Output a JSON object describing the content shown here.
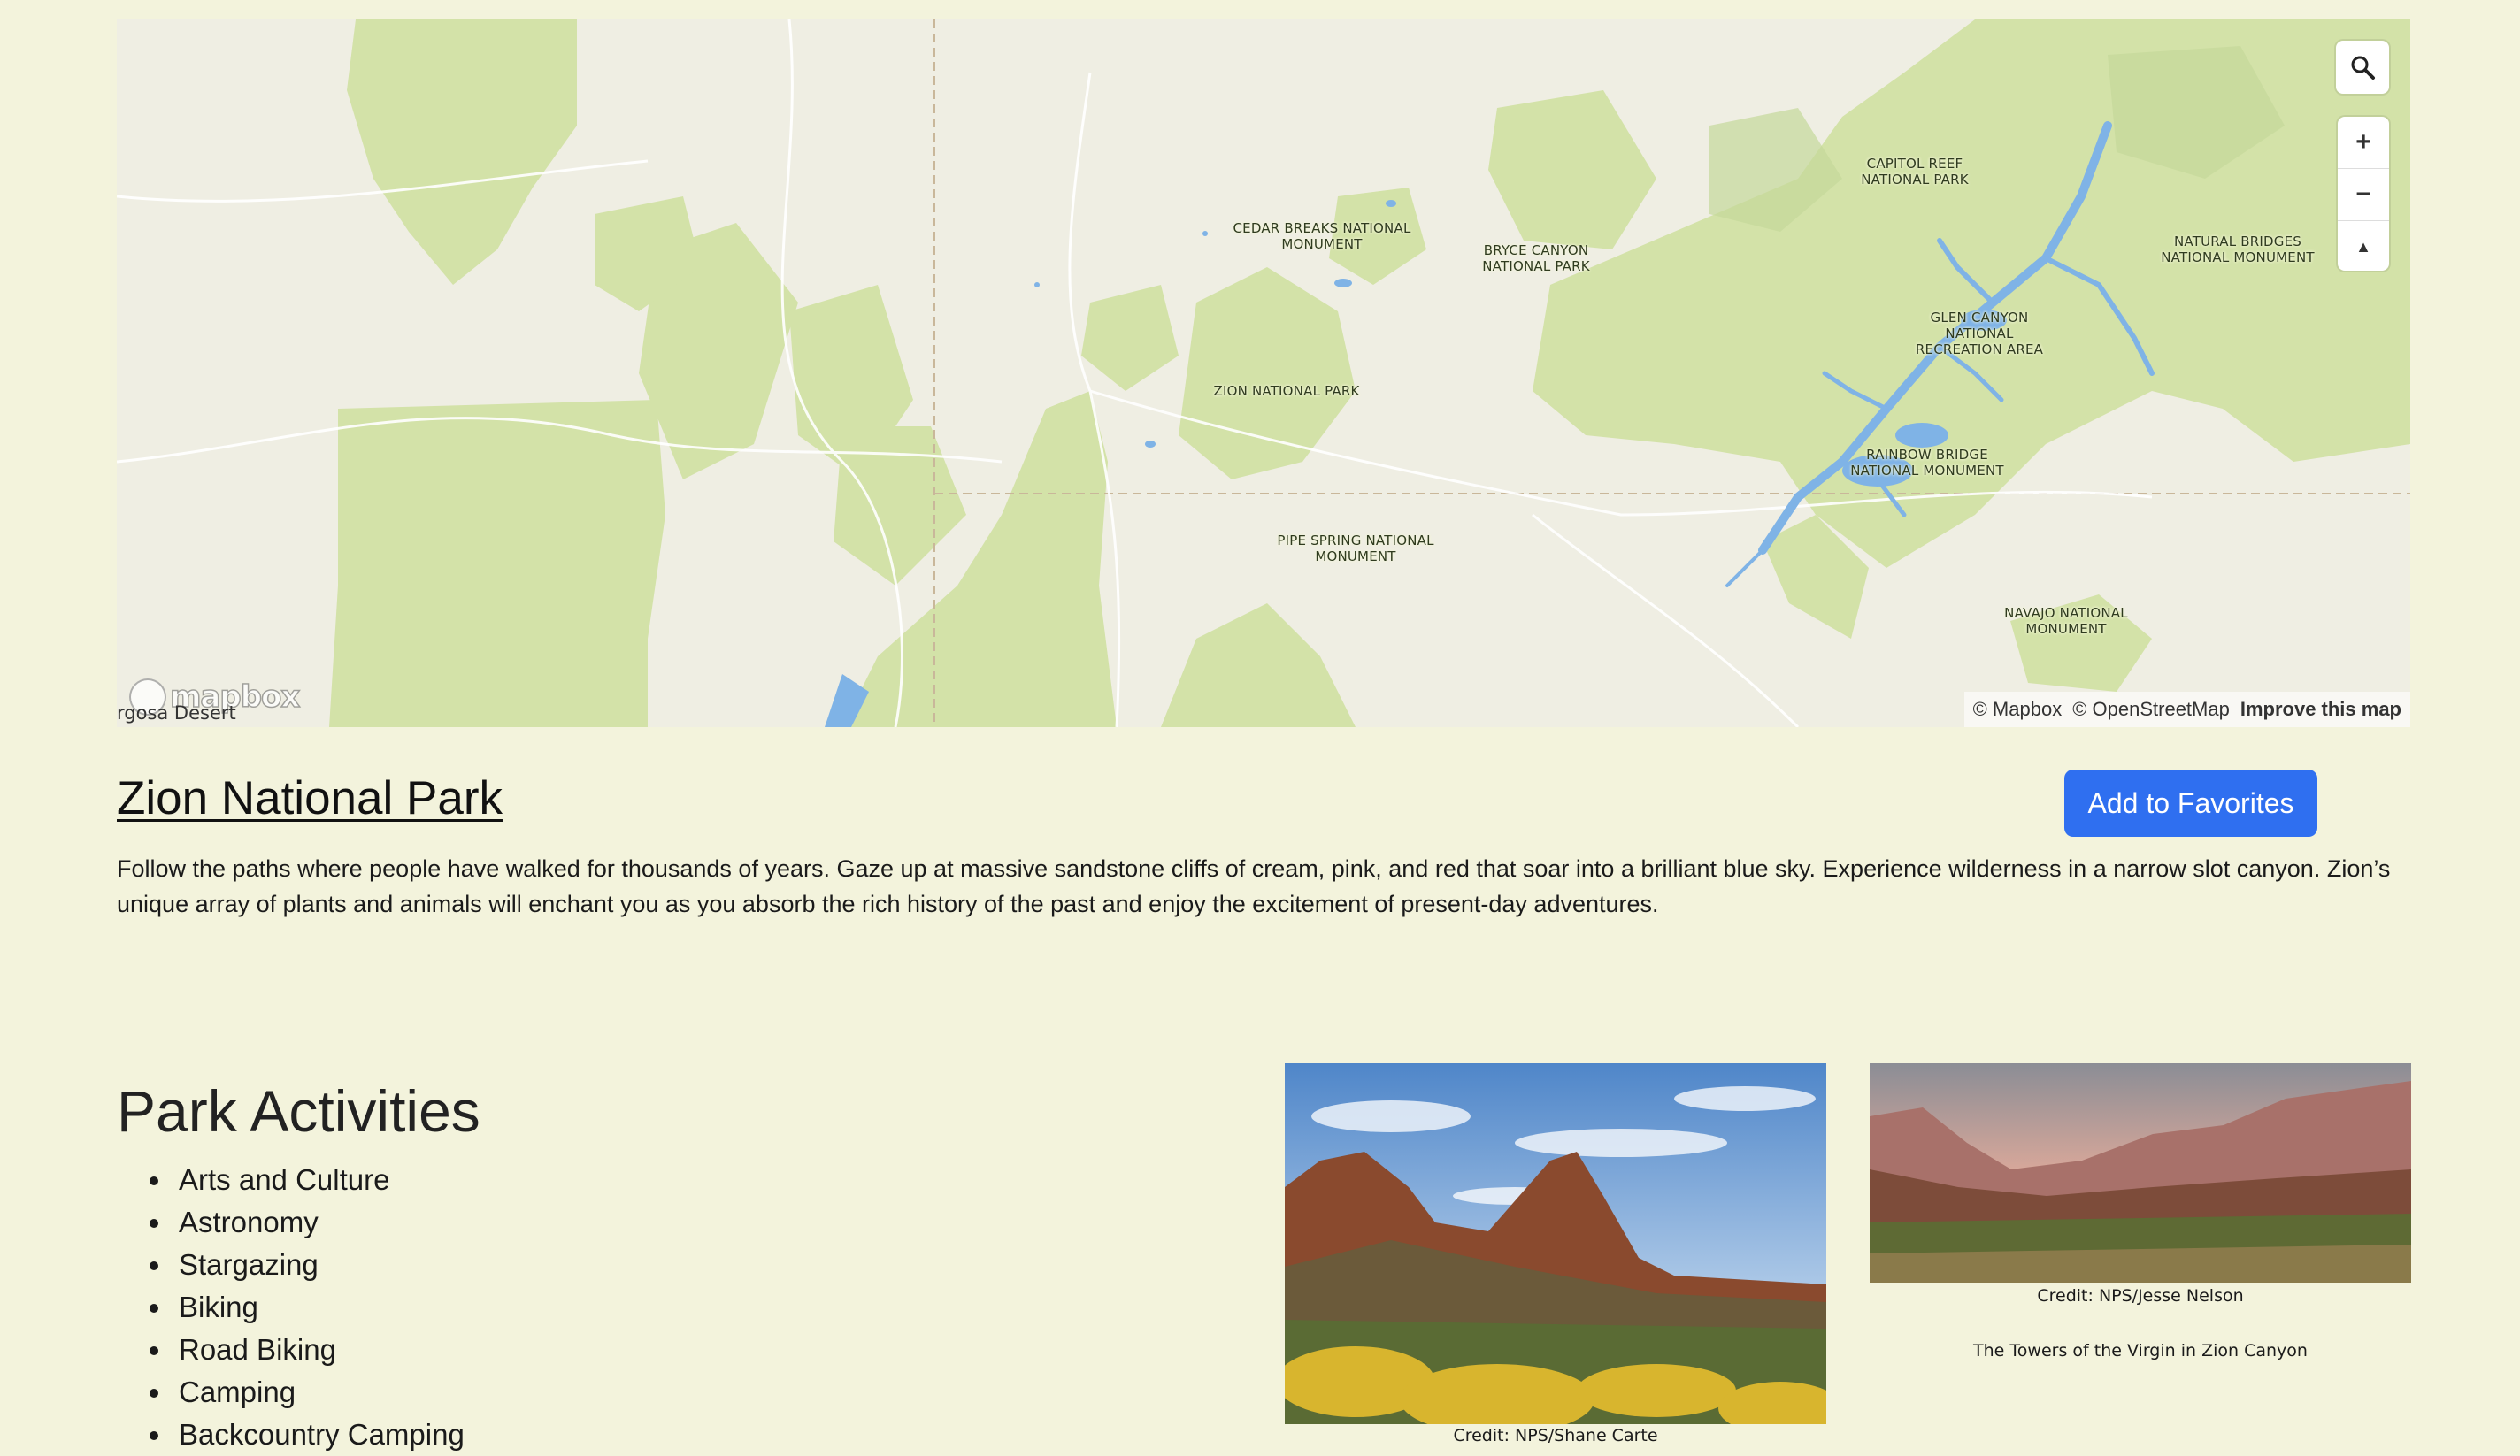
{
  "map": {
    "labels": [
      "CEDAR BREAKS NATIONAL\nMONUMENT",
      "BRYCE CANYON\nNATIONAL PARK",
      "CAPITOL REEF\nNATIONAL PARK",
      "NATURAL BRIDGES\nNATIONAL MONUMENT",
      "GLEN CANYON\nNATIONAL\nRECREATION AREA",
      "ZION NATIONAL PARK",
      "RAINBOW BRIDGE\nNATIONAL MONUMENT",
      "PIPE SPRING NATIONAL\nMONUMENT",
      "NAVAJO NATIONAL\nMONUMENT"
    ],
    "desert_label": "rgosa Desert",
    "logo_text": "mapbox",
    "attribution": {
      "mapbox": "© Mapbox",
      "osm": "© OpenStreetMap",
      "improve": "Improve this map"
    },
    "controls": {
      "search_icon": "search-icon",
      "zoom_in": "+",
      "zoom_out": "−",
      "compass": "▲"
    },
    "colors": {
      "land": "#efeee3",
      "park": "#d3e2a8",
      "water": "#7fb3e6"
    }
  },
  "park": {
    "title": "Zion National Park",
    "favorite_button": "Add to Favorites",
    "description": "Follow the paths where people have walked for thousands of years. Gaze up at massive sandstone cliffs of cream, pink, and red that soar into a brilliant blue sky. Experience wilderness in a narrow slot canyon. Zion’s unique array of plants and animals will enchant you as you absorb the rich history of the past and enjoy the excitement of present-day adventures."
  },
  "activities": {
    "heading": "Park Activities",
    "items": [
      "Arts and Culture",
      "Astronomy",
      "Stargazing",
      "Biking",
      "Road Biking",
      "Camping",
      "Backcountry Camping"
    ]
  },
  "photos": [
    {
      "credit": "Credit: NPS/Shane Carte",
      "title": ""
    },
    {
      "credit": "Credit: NPS/Jesse Nelson",
      "title": "The Towers of the Virgin in Zion Canyon"
    }
  ],
  "colors": {
    "background": "#f3f3dc",
    "accent": "#2f6ff0"
  }
}
